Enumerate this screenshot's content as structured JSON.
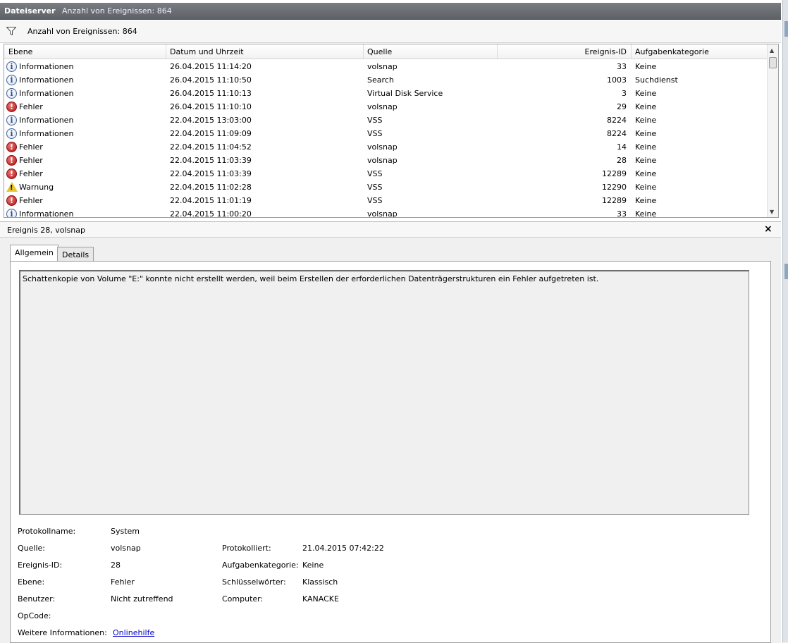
{
  "titlebar": {
    "app": "Dateiserver",
    "count": "Anzahl von Ereignissen: 864"
  },
  "filter": {
    "icon": "filter-icon",
    "text": "Anzahl von Ereignissen: 864"
  },
  "columns": {
    "level": "Ebene",
    "date": "Datum und Uhrzeit",
    "source": "Quelle",
    "id": "Ereignis-ID",
    "category": "Aufgabenkategorie"
  },
  "events": [
    {
      "icon": "info",
      "level": "Informationen",
      "date": "26.04.2015 11:14:20",
      "source": "volsnap",
      "id": "33",
      "category": "Keine"
    },
    {
      "icon": "info",
      "level": "Informationen",
      "date": "26.04.2015 11:10:50",
      "source": "Search",
      "id": "1003",
      "category": "Suchdienst"
    },
    {
      "icon": "info",
      "level": "Informationen",
      "date": "26.04.2015 11:10:13",
      "source": "Virtual Disk Service",
      "id": "3",
      "category": "Keine"
    },
    {
      "icon": "error",
      "level": "Fehler",
      "date": "26.04.2015 11:10:10",
      "source": "volsnap",
      "id": "29",
      "category": "Keine"
    },
    {
      "icon": "info",
      "level": "Informationen",
      "date": "22.04.2015 13:03:00",
      "source": "VSS",
      "id": "8224",
      "category": "Keine"
    },
    {
      "icon": "info",
      "level": "Informationen",
      "date": "22.04.2015 11:09:09",
      "source": "VSS",
      "id": "8224",
      "category": "Keine"
    },
    {
      "icon": "error",
      "level": "Fehler",
      "date": "22.04.2015 11:04:52",
      "source": "volsnap",
      "id": "14",
      "category": "Keine"
    },
    {
      "icon": "error",
      "level": "Fehler",
      "date": "22.04.2015 11:03:39",
      "source": "volsnap",
      "id": "28",
      "category": "Keine"
    },
    {
      "icon": "error",
      "level": "Fehler",
      "date": "22.04.2015 11:03:39",
      "source": "VSS",
      "id": "12289",
      "category": "Keine"
    },
    {
      "icon": "warning",
      "level": "Warnung",
      "date": "22.04.2015 11:02:28",
      "source": "VSS",
      "id": "12290",
      "category": "Keine"
    },
    {
      "icon": "error",
      "level": "Fehler",
      "date": "22.04.2015 11:01:19",
      "source": "VSS",
      "id": "12289",
      "category": "Keine"
    },
    {
      "icon": "info",
      "level": "Informationen",
      "date": "22.04.2015 11:00:20",
      "source": "volsnap",
      "id": "33",
      "category": "Keine"
    }
  ],
  "detail": {
    "title": "Ereignis 28, volsnap",
    "close": "×",
    "tabs": {
      "general": "Allgemein",
      "details": "Details"
    },
    "message": "Schattenkopie von Volume \"E:\" konnte nicht erstellt werden, weil beim Erstellen der erforderlichen Datenträgerstrukturen ein Fehler aufgetreten ist.",
    "fields": {
      "logname_label": "Protokollname:",
      "logname": "System",
      "source_label": "Quelle:",
      "source": "volsnap",
      "logged_label": "Protokolliert:",
      "logged": "21.04.2015 07:42:22",
      "eventid_label": "Ereignis-ID:",
      "eventid": "28",
      "taskcat_label": "Aufgabenkategorie:",
      "taskcat": "Keine",
      "level_label": "Ebene:",
      "level": "Fehler",
      "keywords_label": "Schlüsselwörter:",
      "keywords": "Klassisch",
      "user_label": "Benutzer:",
      "user": "Nicht zutreffend",
      "computer_label": "Computer:",
      "computer": "KANACKE",
      "opcode_label": "OpCode:",
      "opcode": "",
      "moreinfo_label": "Weitere Informationen:",
      "moreinfo_link": "Onlinehilfe"
    }
  }
}
